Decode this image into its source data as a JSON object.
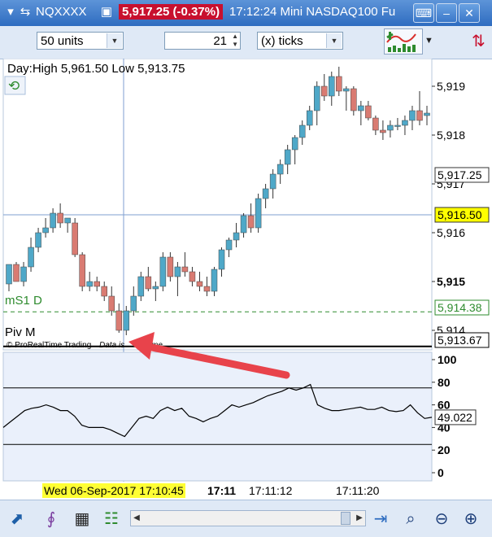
{
  "titlebar": {
    "symbol": "NQXXXX",
    "price_change": "5,917.25 (-0.37%)",
    "time_product": "17:12:24 Mini NASDAQ100 Fu",
    "colors": {
      "bar": "#3b78c9",
      "price_bg": "#c8102e"
    }
  },
  "toolbar": {
    "units_value": "50 units",
    "ticks_count": "21",
    "ticks_unit": "(x) ticks"
  },
  "chart": {
    "header": "Day:High 5,961.50 Low 5,913.75",
    "label_ms1": "mS1 D",
    "label_piv": "Piv M",
    "copyright": "© ProRealTime Trading",
    "data_note": "Data is",
    "data_note_end": "time",
    "price_ticks": [
      "5,919",
      "5,918",
      "5,917",
      "5,916",
      "5,915",
      "5,914"
    ],
    "price_badges": {
      "crosshair": "5,917.25",
      "current": "5,916.50",
      "ms1": "5,914.38",
      "piv": "5,913.67"
    },
    "osc_ticks": [
      "100",
      "80",
      "60",
      "40",
      "20",
      "0"
    ],
    "osc_value": "49.022",
    "time_cursor": "Wed 06-Sep-2017 17:10:45",
    "time_ticks": [
      "17:11",
      "17:11:12",
      "17:11:20"
    ],
    "colors": {
      "up": "#4fa8c8",
      "down": "#d97b72",
      "ms1": "#2e8b2e",
      "badge_current": "#ffff00",
      "arrow": "#e8434b"
    }
  },
  "chart_data": {
    "type": "candlestick",
    "price_range": [
      5913.7,
      5919.5
    ],
    "candles": [
      {
        "o": 5914.95,
        "h": 5915.3,
        "l": 5914.8,
        "c": 5915.35
      },
      {
        "o": 5915.35,
        "h": 5915.4,
        "l": 5915.0,
        "c": 5915.0
      },
      {
        "o": 5915.0,
        "h": 5915.4,
        "l": 5914.9,
        "c": 5915.3
      },
      {
        "o": 5915.3,
        "h": 5915.9,
        "l": 5915.2,
        "c": 5915.7
      },
      {
        "o": 5915.7,
        "h": 5916.1,
        "l": 5915.6,
        "c": 5916.0
      },
      {
        "o": 5916.0,
        "h": 5916.3,
        "l": 5915.9,
        "c": 5916.1
      },
      {
        "o": 5916.1,
        "h": 5916.5,
        "l": 5916.0,
        "c": 5916.4
      },
      {
        "o": 5916.4,
        "h": 5916.6,
        "l": 5916.1,
        "c": 5916.2
      },
      {
        "o": 5916.2,
        "h": 5916.3,
        "l": 5916.0,
        "c": 5916.3
      },
      {
        "o": 5916.2,
        "h": 5916.3,
        "l": 5915.5,
        "c": 5915.55
      },
      {
        "o": 5915.55,
        "h": 5915.6,
        "l": 5914.8,
        "c": 5914.9
      },
      {
        "o": 5914.9,
        "h": 5915.2,
        "l": 5914.8,
        "c": 5915.0
      },
      {
        "o": 5915.0,
        "h": 5915.1,
        "l": 5914.8,
        "c": 5914.9
      },
      {
        "o": 5914.9,
        "h": 5915.0,
        "l": 5914.6,
        "c": 5914.7
      },
      {
        "o": 5914.7,
        "h": 5914.9,
        "l": 5914.3,
        "c": 5914.4
      },
      {
        "o": 5914.4,
        "h": 5914.55,
        "l": 5913.95,
        "c": 5914.0
      },
      {
        "o": 5914.0,
        "h": 5914.5,
        "l": 5913.9,
        "c": 5914.4
      },
      {
        "o": 5914.4,
        "h": 5914.9,
        "l": 5914.3,
        "c": 5914.7
      },
      {
        "o": 5914.7,
        "h": 5915.2,
        "l": 5914.6,
        "c": 5915.1
      },
      {
        "o": 5915.1,
        "h": 5915.3,
        "l": 5914.8,
        "c": 5914.85
      },
      {
        "o": 5914.85,
        "h": 5915.0,
        "l": 5914.6,
        "c": 5914.9
      },
      {
        "o": 5914.9,
        "h": 5915.6,
        "l": 5914.8,
        "c": 5915.5
      },
      {
        "o": 5915.5,
        "h": 5915.6,
        "l": 5915.0,
        "c": 5915.1
      },
      {
        "o": 5915.1,
        "h": 5915.4,
        "l": 5914.7,
        "c": 5915.3
      },
      {
        "o": 5915.3,
        "h": 5915.6,
        "l": 5915.1,
        "c": 5915.2
      },
      {
        "o": 5915.2,
        "h": 5915.3,
        "l": 5914.9,
        "c": 5915.0
      },
      {
        "o": 5915.0,
        "h": 5915.2,
        "l": 5914.8,
        "c": 5914.9
      },
      {
        "o": 5914.9,
        "h": 5915.1,
        "l": 5914.7,
        "c": 5914.8
      },
      {
        "o": 5914.8,
        "h": 5915.3,
        "l": 5914.7,
        "c": 5915.25
      },
      {
        "o": 5915.25,
        "h": 5915.7,
        "l": 5915.1,
        "c": 5915.65
      },
      {
        "o": 5915.65,
        "h": 5915.9,
        "l": 5915.5,
        "c": 5915.85
      },
      {
        "o": 5915.85,
        "h": 5916.2,
        "l": 5915.7,
        "c": 5916.0
      },
      {
        "o": 5916.0,
        "h": 5916.4,
        "l": 5915.9,
        "c": 5916.35
      },
      {
        "o": 5916.35,
        "h": 5916.6,
        "l": 5916.0,
        "c": 5916.1
      },
      {
        "o": 5916.1,
        "h": 5916.8,
        "l": 5916.0,
        "c": 5916.7
      },
      {
        "o": 5916.7,
        "h": 5917.0,
        "l": 5916.5,
        "c": 5916.9
      },
      {
        "o": 5916.9,
        "h": 5917.3,
        "l": 5916.7,
        "c": 5917.2
      },
      {
        "o": 5917.2,
        "h": 5917.5,
        "l": 5917.0,
        "c": 5917.4
      },
      {
        "o": 5917.4,
        "h": 5917.8,
        "l": 5917.2,
        "c": 5917.7
      },
      {
        "o": 5917.7,
        "h": 5918.0,
        "l": 5917.4,
        "c": 5917.95
      },
      {
        "o": 5917.95,
        "h": 5918.3,
        "l": 5917.8,
        "c": 5918.2
      },
      {
        "o": 5918.2,
        "h": 5918.6,
        "l": 5918.1,
        "c": 5918.5
      },
      {
        "o": 5918.5,
        "h": 5919.1,
        "l": 5918.2,
        "c": 5919.0
      },
      {
        "o": 5919.0,
        "h": 5919.25,
        "l": 5918.7,
        "c": 5918.8
      },
      {
        "o": 5918.8,
        "h": 5919.3,
        "l": 5918.6,
        "c": 5919.2
      },
      {
        "o": 5919.2,
        "h": 5919.4,
        "l": 5918.8,
        "c": 5918.9
      },
      {
        "o": 5918.9,
        "h": 5919.0,
        "l": 5918.5,
        "c": 5918.95
      },
      {
        "o": 5918.95,
        "h": 5919.0,
        "l": 5918.4,
        "c": 5918.5
      },
      {
        "o": 5918.5,
        "h": 5918.7,
        "l": 5918.2,
        "c": 5918.6
      },
      {
        "o": 5918.6,
        "h": 5918.7,
        "l": 5918.3,
        "c": 5918.35
      },
      {
        "o": 5918.35,
        "h": 5918.4,
        "l": 5918.0,
        "c": 5918.1
      },
      {
        "o": 5918.1,
        "h": 5918.3,
        "l": 5917.9,
        "c": 5918.05
      },
      {
        "o": 5918.1,
        "h": 5918.3,
        "l": 5917.95,
        "c": 5918.2
      },
      {
        "o": 5918.2,
        "h": 5918.35,
        "l": 5918.1,
        "c": 5918.2
      },
      {
        "o": 5918.2,
        "h": 5918.4,
        "l": 5918.0,
        "c": 5918.3
      },
      {
        "o": 5918.3,
        "h": 5918.6,
        "l": 5918.1,
        "c": 5918.5
      },
      {
        "o": 5918.5,
        "h": 5918.9,
        "l": 5918.2,
        "c": 5918.3
      },
      {
        "o": 5918.4,
        "h": 5918.6,
        "l": 5918.2,
        "c": 5918.45
      }
    ],
    "levels": {
      "ms1": 5914.38,
      "piv": 5913.67,
      "current": 5916.5,
      "crosshair": 5917.25
    },
    "oscillator": {
      "range": [
        0,
        100
      ],
      "hlines": [
        75,
        25
      ],
      "values": [
        40,
        45,
        50,
        55,
        57,
        58,
        60,
        58,
        55,
        55,
        50,
        42,
        40,
        40,
        40,
        38,
        35,
        32,
        40,
        48,
        50,
        48,
        55,
        58,
        55,
        57,
        50,
        48,
        45,
        48,
        50,
        55,
        60,
        58,
        60,
        62,
        65,
        68,
        70,
        72,
        75,
        73,
        75,
        78,
        60,
        57,
        55,
        55,
        56,
        57,
        58,
        56,
        56,
        58,
        55,
        54,
        55,
        60,
        53,
        48,
        49
      ]
    }
  }
}
